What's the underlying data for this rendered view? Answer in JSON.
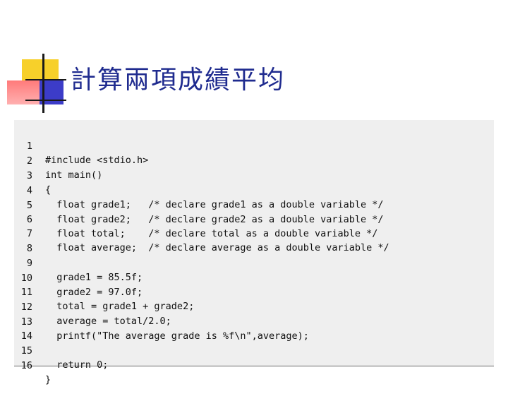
{
  "slide": {
    "title": "計算兩項成績平均"
  },
  "code": {
    "lines": [
      {
        "n": "1",
        "text": "#include <stdio.h>"
      },
      {
        "n": "2",
        "text": "int main()"
      },
      {
        "n": "3",
        "text": "{"
      },
      {
        "n": "4",
        "text": "  float grade1;   /* declare grade1 as a double variable */"
      },
      {
        "n": "5",
        "text": "  float grade2;   /* declare grade2 as a double variable */"
      },
      {
        "n": "6",
        "text": "  float total;    /* declare total as a double variable */"
      },
      {
        "n": "7",
        "text": "  float average;  /* declare average as a double variable */"
      },
      {
        "n": "8",
        "text": ""
      },
      {
        "n": "9",
        "text": "  grade1 = 85.5f;"
      },
      {
        "n": "10",
        "text": "  grade2 = 97.0f;"
      },
      {
        "n": "11",
        "text": "  total = grade1 + grade2;"
      },
      {
        "n": "12",
        "text": "  average = total/2.0;"
      },
      {
        "n": "13",
        "text": "  printf(\"The average grade is %f\\n\",average);"
      },
      {
        "n": "14",
        "text": ""
      },
      {
        "n": "15",
        "text": "  return 0;"
      },
      {
        "n": "16",
        "text": "}"
      }
    ]
  },
  "colors": {
    "title": "#1f2b8f",
    "panel": "#efefef",
    "accent_yellow": "#f7d02a",
    "accent_red": "#ff7a7a",
    "accent_blue": "#3c3cc8"
  }
}
